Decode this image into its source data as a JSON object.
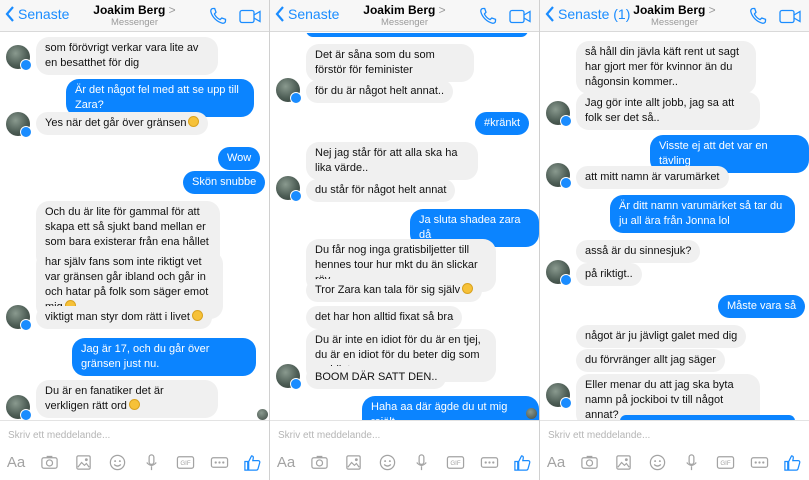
{
  "colors": {
    "accent": "#1a8cff",
    "outgoing": "#0b84ff",
    "incoming": "#f0f0f0"
  },
  "composer": {
    "placeholder": "Skriv ett meddelande...",
    "icons": [
      "aa-text-icon",
      "camera-icon",
      "gallery-icon",
      "emoji-icon",
      "microphone-icon",
      "gif-icon",
      "more-icon",
      "like-icon"
    ],
    "aa_label": "Aa",
    "gif_label": "GIF"
  },
  "panels": [
    {
      "back_label": "Senaste",
      "contact_name": "Joakim Berg",
      "contact_arrow": ">",
      "subtitle": "Messenger",
      "messages": [
        {
          "dir": "in",
          "text": "som förövrigt verkar vara lite av en besatthet för dig"
        },
        {
          "dir": "out",
          "text": "Är det något fel med att se upp till Zara?"
        },
        {
          "dir": "in",
          "text": "Yes när det går över gränsen",
          "emoji": true
        },
        {
          "dir": "out",
          "text": "Wow"
        },
        {
          "dir": "out",
          "text": "Skön snubbe"
        },
        {
          "dir": "in",
          "text": "Och du är lite för gammal för att skapa ett så sjukt band mellan er som bara existerar från ena hållet dvs ditt håll"
        },
        {
          "dir": "in",
          "text": "har själv fans som inte riktigt vet var gränsen går ibland och går in och hatar på folk som säger emot mig",
          "emoji": true
        },
        {
          "dir": "in",
          "text": "viktigt man styr dom rätt i livet",
          "emoji": true
        },
        {
          "dir": "out",
          "text": "Jag är 17, och du går över gränsen just nu."
        },
        {
          "dir": "in",
          "text": "Du är en fanatiker det är verkligen rätt ord",
          "emoji": true
        }
      ]
    },
    {
      "back_label": "Senaste",
      "contact_name": "Joakim Berg",
      "contact_arrow": ">",
      "subtitle": "Messenger",
      "messages": [
        {
          "dir": "in",
          "text": "Det är såna som du som förstör för feminister"
        },
        {
          "dir": "in",
          "text": "för du är något helt annat.."
        },
        {
          "dir": "out",
          "text": "#kränkt"
        },
        {
          "dir": "in",
          "text": "Nej jag står för att alla ska ha lika värde.."
        },
        {
          "dir": "in",
          "text": "du står för något helt annat"
        },
        {
          "dir": "out",
          "text": "Ja sluta shadea zara då"
        },
        {
          "dir": "in",
          "text": "Du får nog inga gratisbiljetter till hennes tour hur mkt du än slickar röv"
        },
        {
          "dir": "in",
          "text": "Tror Zara kan tala för sig själv",
          "emoji": true
        },
        {
          "dir": "in",
          "text": "det har hon alltid fixat så bra"
        },
        {
          "dir": "in",
          "text": "Du är inte en idiot för du är en tjej, du är en idiot för du beter dig som en idiot"
        },
        {
          "dir": "in",
          "text": "BOOM DÄR SATT DEN.."
        },
        {
          "dir": "out",
          "text": "Haha aa där ägde du ut mig rejält"
        }
      ]
    },
    {
      "back_label": "Senaste (1)",
      "contact_name": "Joakim Berg",
      "contact_arrow": ">",
      "subtitle": "Messenger",
      "messages": [
        {
          "dir": "in",
          "text": "så håll din jävla käft rent ut sagt har gjort mer för kvinnor än du någonsin kommer.."
        },
        {
          "dir": "in",
          "text": "Jag gör inte allt jobb, jag sa att folk ser det så.."
        },
        {
          "dir": "out",
          "text": "Visste ej att det var en tävling"
        },
        {
          "dir": "in",
          "text": "att mitt namn är varumärket"
        },
        {
          "dir": "out",
          "text": "Är ditt namn varumärket så tar du ju all ära från Jonna lol"
        },
        {
          "dir": "in",
          "text": "asså är du sinnesjuk?"
        },
        {
          "dir": "in",
          "text": "på riktigt.."
        },
        {
          "dir": "out",
          "text": "Måste vara så"
        },
        {
          "dir": "in",
          "text": "något är ju jävligt galet med dig"
        },
        {
          "dir": "in",
          "text": "du förvränger allt jag säger"
        },
        {
          "dir": "in",
          "text": "Eller menar du att jag ska byta namn på jockiboi tv till något annat?"
        }
      ]
    }
  ]
}
